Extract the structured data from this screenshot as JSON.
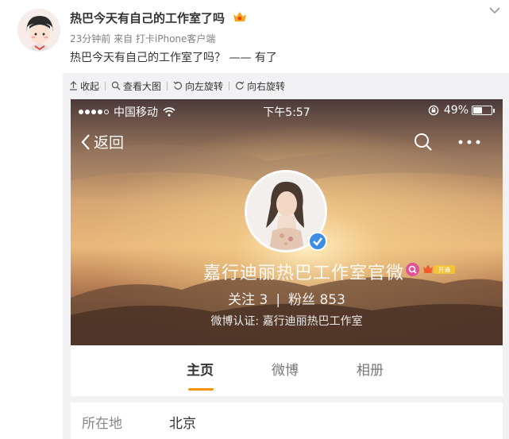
{
  "post": {
    "author": "热巴今天有自己的工作室了吗",
    "meta": "23分钟前 来自 打卡iPhone客户端",
    "text": "热巴今天有自己的工作室了吗？ —— 有了"
  },
  "media_toolbar": {
    "collapse": "收起",
    "view_large": "查看大图",
    "rotate_left": "向左旋转",
    "rotate_right": "向右旋转"
  },
  "phone": {
    "status_bar": {
      "carrier": "中国移动",
      "time": "下午5:57",
      "battery": "49%",
      "battery_level": 0.49
    },
    "nav": {
      "back": "返回"
    },
    "profile": {
      "name": "嘉行迪丽热巴工作室官微",
      "vip_label": "开通",
      "following_label": "关注",
      "following_count": "3",
      "followers_label": "粉丝",
      "followers_count": "853",
      "verification": "微博认证: 嘉行迪丽热巴工作室"
    },
    "tabs": [
      {
        "label": "主页",
        "active": true
      },
      {
        "label": "微博",
        "active": false
      },
      {
        "label": "相册",
        "active": false
      }
    ],
    "info": {
      "label": "所在地",
      "value": "北京"
    }
  },
  "colors": {
    "accent_orange": "#f59200",
    "verified_blue": "#3d8de6",
    "weibo_pink": "#e35196"
  }
}
